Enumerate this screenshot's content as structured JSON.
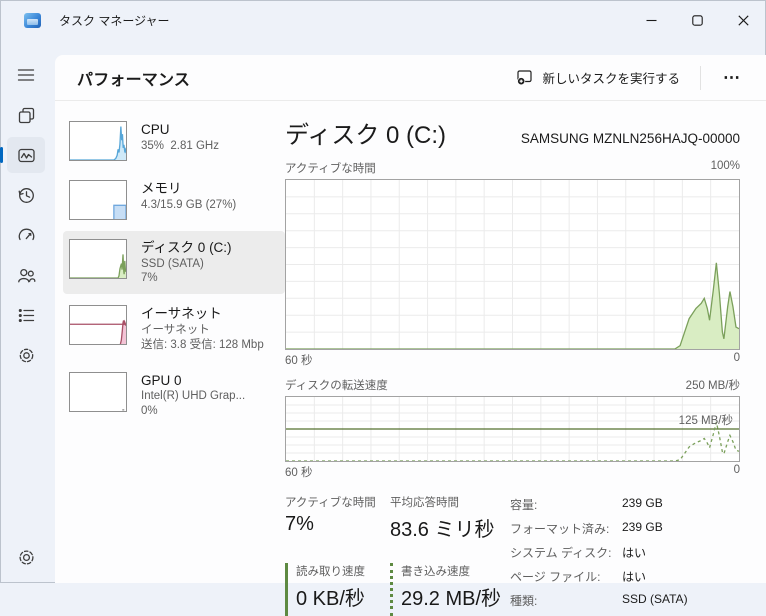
{
  "window": {
    "title": "タスク マネージャー"
  },
  "header": {
    "title": "パフォーマンス",
    "run_new_task": "新しいタスクを実行する",
    "more": "⋯"
  },
  "sidebar": {
    "items": [
      {
        "icon": "hamburger-menu-icon"
      },
      {
        "icon": "processes-icon"
      },
      {
        "icon": "performance-icon",
        "selected": true
      },
      {
        "icon": "app-history-icon"
      },
      {
        "icon": "startup-apps-icon"
      },
      {
        "icon": "users-icon"
      },
      {
        "icon": "details-icon"
      },
      {
        "icon": "services-icon"
      },
      {
        "icon": "settings-gear-icon"
      }
    ],
    "accent_color": "#0067c0"
  },
  "perf_list": [
    {
      "title": "CPU",
      "line2": "35%  2.81 GHz"
    },
    {
      "title": "メモリ",
      "line2": "4.3/15.9 GB (27%)"
    },
    {
      "title": "ディスク 0 (C:)",
      "line2": "SSD (SATA)",
      "line3": "7%",
      "selected": true
    },
    {
      "title": "イーサネット",
      "line2": "イーサネット",
      "line3": "送信: 3.8 受信: 128 Mbp"
    },
    {
      "title": "GPU 0",
      "line2": "Intel(R) UHD Grap...",
      "line3": "0%"
    }
  ],
  "detail": {
    "title": "ディスク 0 (C:)",
    "subtitle": "SAMSUNG MZNLN256HAJQ-00000",
    "chart1": {
      "label": "アクティブな時間",
      "max_label": "100%",
      "x_left": "60 秒",
      "x_right": "0"
    },
    "chart2": {
      "label": "ディスクの転送速度",
      "max_label": "250 MB/秒",
      "mid_label": "125 MB/秒",
      "x_left": "60 秒",
      "x_right": "0"
    },
    "stats": [
      {
        "label": "アクティブな時間",
        "value": "7%"
      },
      {
        "label": "平均応答時間",
        "value": "83.6 ミリ秒"
      },
      {
        "label": "読み取り速度",
        "value": "0 KB/秒",
        "marker": "solid"
      },
      {
        "label": "書き込み速度",
        "value": "29.2 MB/秒",
        "marker": "dotted"
      }
    ],
    "props": [
      {
        "label": "容量:",
        "value": "239 GB"
      },
      {
        "label": "フォーマット済み:",
        "value": "239 GB"
      },
      {
        "label": "システム ディスク:",
        "value": "はい"
      },
      {
        "label": "ページ ファイル:",
        "value": "はい"
      },
      {
        "label": "種類:",
        "value": "SSD (SATA)"
      }
    ]
  },
  "colors": {
    "disk_chart_fill": "#d9edc3",
    "disk_chart_stroke": "#7ba05b",
    "midline": "#55702e",
    "cpu_fill": "#cfe9f8",
    "cpu_stroke": "#56a6d8",
    "memory_fill": "#c7def5",
    "memory_stroke": "#70a8de",
    "ethernet_fill": "#f3c4d6",
    "ethernet_stroke": "#a84f66",
    "accent": "#0067c0",
    "selected_bg": "#ececec"
  },
  "chart_data": [
    {
      "id": "disk-active-time",
      "type": "area",
      "title": "アクティブな時間",
      "xlabel": "秒 (60→0)",
      "ylabel": "アクティブな時間 %",
      "xmax": 60,
      "ymax": 100,
      "ylim": [
        0,
        100
      ],
      "grid": {
        "cols": 16,
        "rows": 10
      },
      "series": [
        {
          "name": "active-time-percent",
          "fill": "#d9edc3",
          "stroke": "#7ba05b",
          "points": [
            [
              60,
              0
            ],
            [
              8.5,
              0
            ],
            [
              7.8,
              2
            ],
            [
              7.2,
              10
            ],
            [
              6.6,
              18
            ],
            [
              5.7,
              24
            ],
            [
              5.0,
              27
            ],
            [
              4.6,
              30
            ],
            [
              4.2,
              24
            ],
            [
              3.9,
              17
            ],
            [
              3.4,
              35
            ],
            [
              3.0,
              51
            ],
            [
              2.6,
              33
            ],
            [
              2.2,
              10
            ],
            [
              2.0,
              6
            ],
            [
              1.5,
              25
            ],
            [
              1.2,
              34
            ],
            [
              0.8,
              25
            ],
            [
              0.4,
              13
            ],
            [
              0,
              12
            ]
          ]
        }
      ]
    },
    {
      "id": "disk-transfer-rate",
      "type": "line",
      "title": "ディスクの転送速度",
      "xlabel": "秒 (60→0)",
      "ylabel": "MB/秒",
      "xmax": 60,
      "ymax": 250,
      "ylim": [
        0,
        250
      ],
      "grid": {
        "cols": 16,
        "rows": 8
      },
      "midline": {
        "value": 125,
        "label": "125 MB/秒",
        "color": "#55702e"
      },
      "series": [
        {
          "name": "write-speed-mbps",
          "stroke": "#7ba05b",
          "dash": "3 3",
          "points": [
            [
              60,
              0
            ],
            [
              8.5,
              0
            ],
            [
              7.8,
              5
            ],
            [
              7.2,
              30
            ],
            [
              6.6,
              55
            ],
            [
              5.7,
              72
            ],
            [
              5.0,
              80
            ],
            [
              4.6,
              88
            ],
            [
              4.2,
              70
            ],
            [
              3.9,
              52
            ],
            [
              3.4,
              105
            ],
            [
              3.0,
              152
            ],
            [
              2.6,
              98
            ],
            [
              2.2,
              35
            ],
            [
              2.0,
              28
            ],
            [
              1.5,
              75
            ],
            [
              1.2,
              100
            ],
            [
              0.8,
              75
            ],
            [
              0.4,
              42
            ],
            [
              0,
              38
            ]
          ]
        }
      ]
    },
    {
      "id": "cpu-spark",
      "type": "area",
      "xmax": 60,
      "ymax": 100,
      "series": [
        {
          "name": "cpu-percent",
          "fill": "#cfe9f8",
          "stroke": "#56a6d8",
          "points": [
            [
              60,
              0
            ],
            [
              13,
              0
            ],
            [
              11,
              4
            ],
            [
              9.5,
              12
            ],
            [
              8.5,
              28
            ],
            [
              7.5,
              20
            ],
            [
              6.5,
              42
            ],
            [
              5.5,
              88
            ],
            [
              4.6,
              52
            ],
            [
              3.8,
              68
            ],
            [
              3.0,
              32
            ],
            [
              2.2,
              40
            ],
            [
              1.4,
              24
            ],
            [
              0.7,
              28
            ],
            [
              0,
              18
            ]
          ]
        }
      ]
    },
    {
      "id": "memory-spark",
      "type": "area",
      "xmax": 60,
      "ymax": 100,
      "series": [
        {
          "name": "memory-used",
          "fill": "#c7def5",
          "stroke": "#70a8de",
          "points": [
            [
              13,
              0
            ],
            [
              13,
              36
            ],
            [
              0,
              36
            ],
            [
              0,
              0
            ]
          ]
        }
      ]
    },
    {
      "id": "disk-spark",
      "type": "area",
      "xmax": 60,
      "ymax": 100,
      "series": [
        {
          "name": "disk-active",
          "fill": "#d9edc3",
          "stroke": "#7ba05b",
          "points": [
            [
              60,
              0
            ],
            [
              8.5,
              0
            ],
            [
              7.5,
              6
            ],
            [
              6.5,
              24
            ],
            [
              5.5,
              33
            ],
            [
              4.8,
              38
            ],
            [
              4.2,
              22
            ],
            [
              3.2,
              62
            ],
            [
              2.4,
              18
            ],
            [
              2.0,
              10
            ],
            [
              1.3,
              45
            ],
            [
              0.6,
              20
            ],
            [
              0,
              16
            ]
          ]
        }
      ]
    },
    {
      "id": "ethernet-spark",
      "type": "line",
      "xmax": 60,
      "ymax": 100,
      "series": [
        {
          "name": "throughput-baseline",
          "stroke": "#a84f66",
          "points": [
            [
              60,
              52
            ],
            [
              0,
              52
            ]
          ]
        },
        {
          "name": "receive-spike",
          "fill": "#f3c4d6",
          "stroke": "#a84f66",
          "points": [
            [
              6,
              0
            ],
            [
              5,
              10
            ],
            [
              4,
              34
            ],
            [
              3.2,
              56
            ],
            [
              2.6,
              62
            ],
            [
              2.0,
              50
            ],
            [
              1.4,
              58
            ],
            [
              0.8,
              54
            ],
            [
              0,
              48
            ]
          ]
        }
      ]
    },
    {
      "id": "gpu-spark",
      "type": "line",
      "xmax": 60,
      "ymax": 100,
      "series": [
        {
          "name": "gpu-percent",
          "stroke": "#8f8f8f",
          "dash": "2 2",
          "points": [
            [
              4,
              3
            ],
            [
              0,
              3
            ]
          ]
        }
      ]
    }
  ]
}
